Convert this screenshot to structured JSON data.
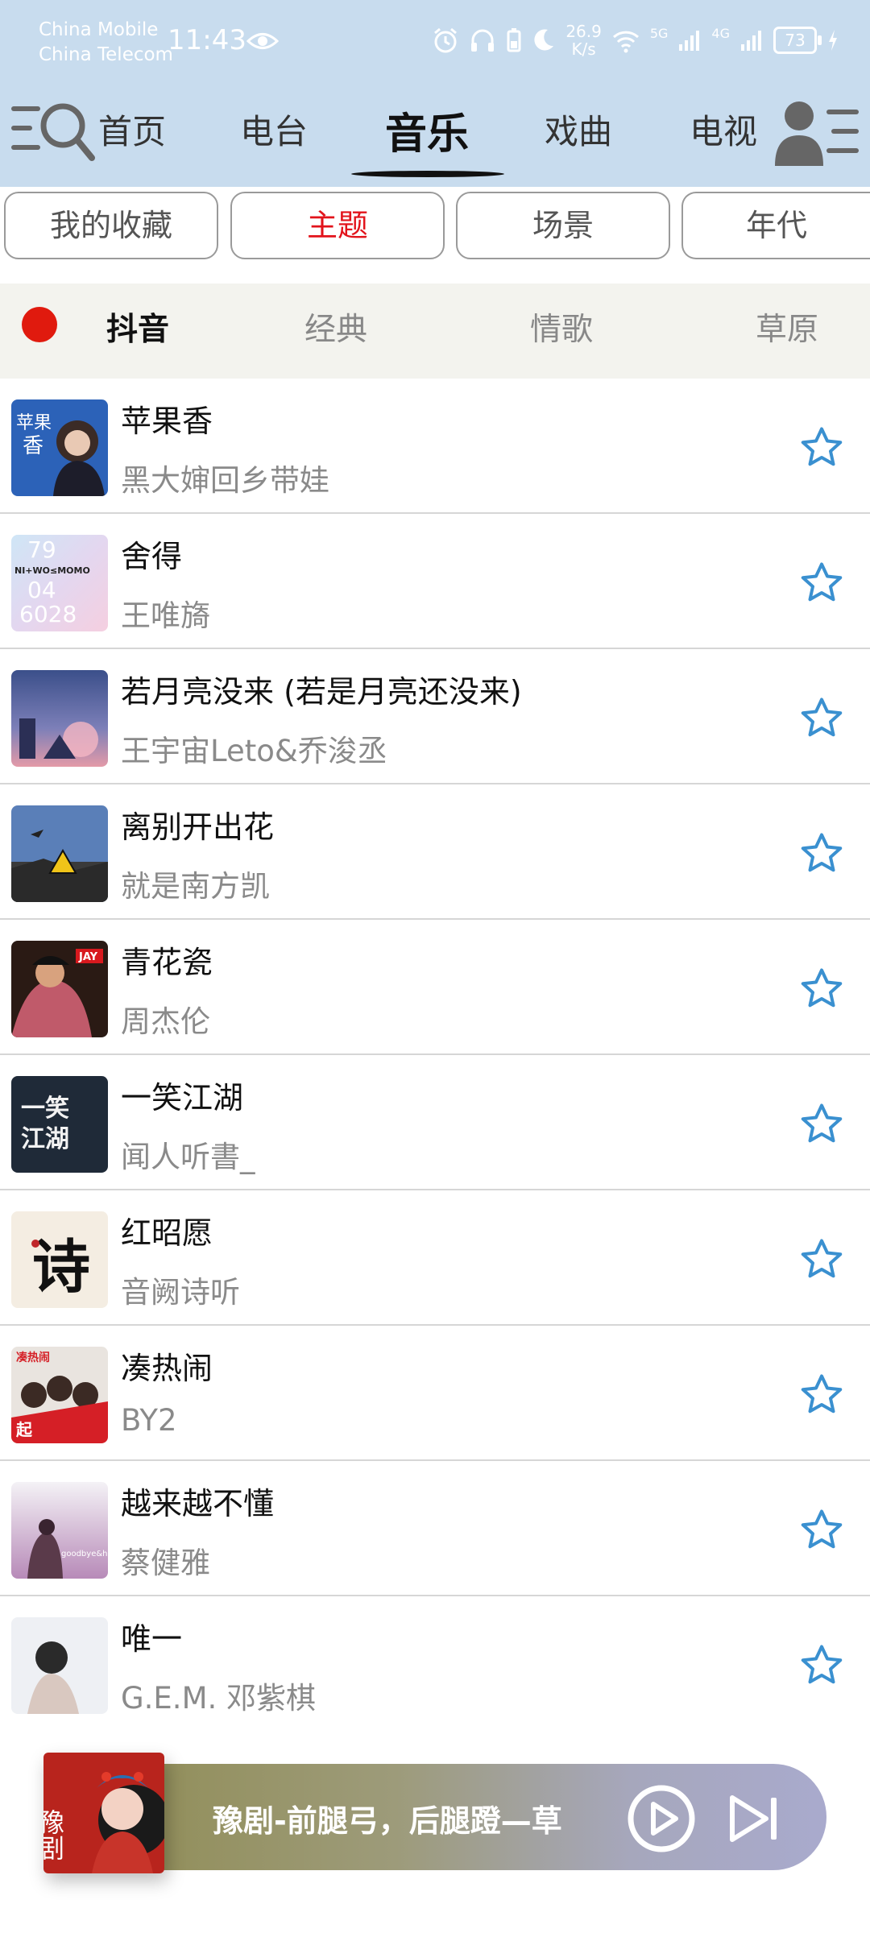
{
  "status_bar": {
    "carrier1": "China Mobile",
    "carrier2": "China Telecom",
    "time": "11:43",
    "speed_value": "26.9",
    "speed_unit": "K/s",
    "net1": "5G",
    "net2": "4G",
    "battery": "73"
  },
  "nav": {
    "tabs": [
      {
        "label": "首页"
      },
      {
        "label": "电台"
      },
      {
        "label": "音乐"
      },
      {
        "label": "戏曲"
      },
      {
        "label": "电视"
      }
    ],
    "active": "音乐"
  },
  "subtabs": [
    {
      "label": "我的收藏"
    },
    {
      "label": "主题"
    },
    {
      "label": "场景"
    },
    {
      "label": "年代"
    }
  ],
  "topics": [
    {
      "label": "抖音"
    },
    {
      "label": "经典"
    },
    {
      "label": "情歌"
    },
    {
      "label": "草原"
    }
  ],
  "songs": [
    {
      "title": "苹果香",
      "artist": "黑大婶回乡带娃"
    },
    {
      "title": "舍得",
      "artist": "王唯旖"
    },
    {
      "title": "若月亮没来 (若是月亮还没来)",
      "artist": "王宇宙Leto&乔浚丞"
    },
    {
      "title": "离别开出花",
      "artist": "就是南方凯"
    },
    {
      "title": "青花瓷",
      "artist": "周杰伦"
    },
    {
      "title": "一笑江湖",
      "artist": "闻人听書_"
    },
    {
      "title": "红昭愿",
      "artist": "音阙诗听"
    },
    {
      "title": "凑热闹",
      "artist": "BY2"
    },
    {
      "title": "越来越不懂",
      "artist": "蔡健雅"
    },
    {
      "title": "唯一",
      "artist": "G.E.M. 邓紫棋"
    }
  ],
  "covers": {
    "c1": {
      "line1": "苹果",
      "line2": "香"
    },
    "c2": {
      "line1": "79",
      "line2": "NI+WO≤MOMO",
      "line3": "04",
      "line4": "6028"
    },
    "c5": {
      "badge": "JAY"
    },
    "c6": {
      "line1": "一笑",
      "line2": "江湖"
    },
    "c7": {
      "glyph": "诗"
    },
    "c8": {
      "line1": "凑热闹",
      "line2": "起"
    },
    "c9": {
      "text": "goodbye&hello"
    }
  },
  "player": {
    "title": "豫剧-前腿弓，后腿蹬—草",
    "cover_text": "豫剧"
  },
  "colors": {
    "header_bg": "#c8dcee",
    "accent_red": "#e2131b",
    "star_blue": "#3a90d0"
  }
}
